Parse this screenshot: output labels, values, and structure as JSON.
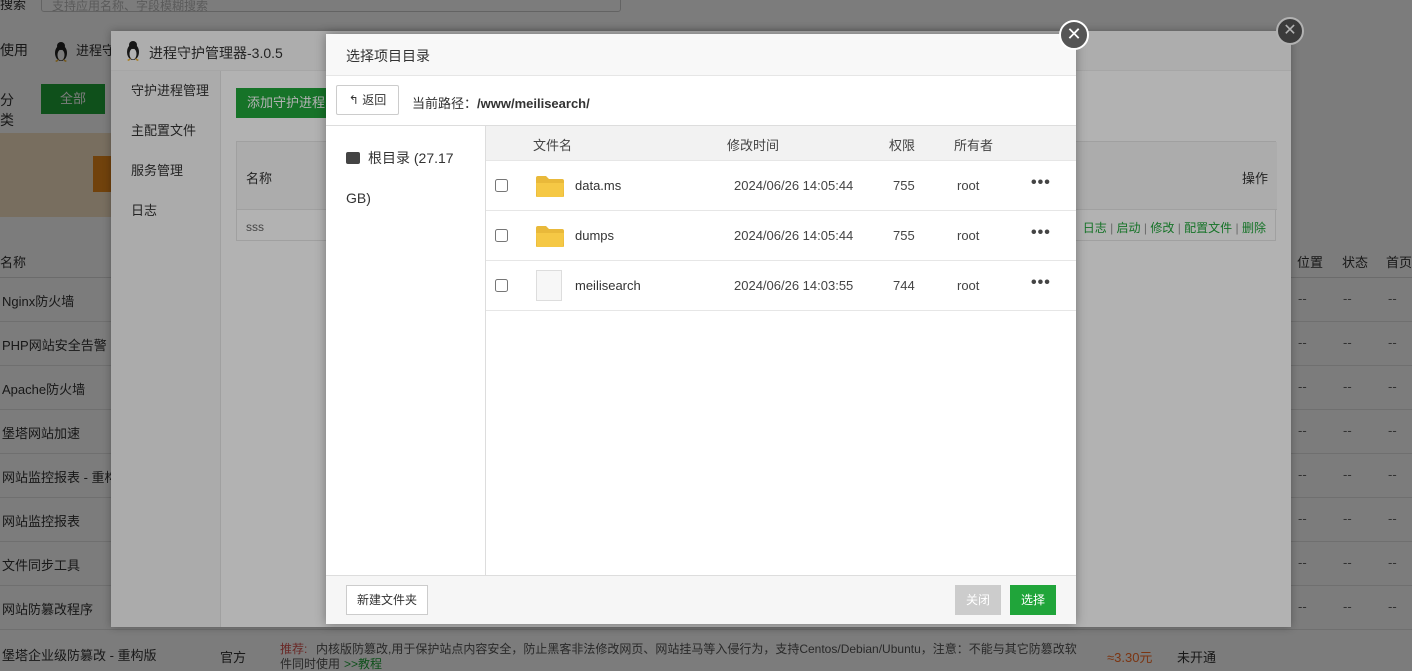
{
  "background": {
    "search_label": "搜索",
    "search_placeholder": "支持应用名称、字段模糊搜索",
    "menu_used": "使用",
    "menu_plugin": "进程守",
    "category_label": "分类",
    "category_all": "全部",
    "table_headers": {
      "name": "名称",
      "location": "位置",
      "status": "状态",
      "home": "首页"
    },
    "rows": [
      {
        "name": "Nginx防火墙",
        "location": "--",
        "status": "--",
        "home": "--"
      },
      {
        "name": "PHP网站安全告警",
        "location": "--",
        "status": "--",
        "home": "--"
      },
      {
        "name": "Apache防火墙",
        "location": "--",
        "status": "--",
        "home": "--"
      },
      {
        "name": "堡塔网站加速",
        "location": "--",
        "status": "--",
        "home": "--"
      },
      {
        "name": "网站监控报表 - 重构版",
        "location": "--",
        "status": "--",
        "home": "--"
      },
      {
        "name": "网站监控报表",
        "location": "--",
        "status": "--",
        "home": "--"
      },
      {
        "name": "文件同步工具",
        "location": "--",
        "status": "--",
        "home": "--"
      },
      {
        "name": "网站防篡改程序",
        "location": "--",
        "status": "--",
        "home": "--"
      }
    ],
    "last_row": {
      "name": "堡塔企业级防篡改 - 重构版",
      "developer": "官方",
      "recommend_label": "推荐:",
      "description_1": "内核版防篡改,用于保护站点内容安全，防止黑客非法修改网页、网站挂马等入侵行为，支持Centos/Debian/Ubuntu，注意：不能与其它防篡改软",
      "description_2": "件同时使用",
      "tutorial_link": ">>教程",
      "price": "≈3.30元",
      "status": "未开通"
    }
  },
  "plugin_window": {
    "title": "进程守护管理器-3.0.5",
    "sidebar": [
      "守护进程管理",
      "主配置文件",
      "服务管理",
      "日志"
    ],
    "add_button": "添加守护进程",
    "table_header_name": "名称",
    "table_header_ops": "操作",
    "row_name": "sss",
    "actions": [
      "日志",
      "启动",
      "修改",
      "配置文件",
      "删除"
    ]
  },
  "dialog": {
    "title": "选择项目目录",
    "back_label": "返回",
    "path_label": "当前路径：",
    "current_path": "/www/meilisearch/",
    "tree_root": "根目录 (27.17 GB)",
    "columns": {
      "name": "文件名",
      "mtime": "修改时间",
      "perm": "权限",
      "owner": "所有者"
    },
    "files": [
      {
        "name": "data.ms",
        "type": "folder",
        "mtime": "2024/06/26 14:05:44",
        "perm": "755",
        "owner": "root",
        "more": "•••"
      },
      {
        "name": "dumps",
        "type": "folder",
        "mtime": "2024/06/26 14:05:44",
        "perm": "755",
        "owner": "root",
        "more": "•••"
      },
      {
        "name": "meilisearch",
        "type": "file",
        "mtime": "2024/06/26 14:03:55",
        "perm": "744",
        "owner": "root",
        "more": "•••"
      }
    ],
    "new_folder_label": "新建文件夹",
    "close_label": "关闭",
    "select_label": "选择",
    "colors": {
      "accent": "#20a53a",
      "folder": "#f5c845",
      "disabled": "#cccccc"
    }
  }
}
